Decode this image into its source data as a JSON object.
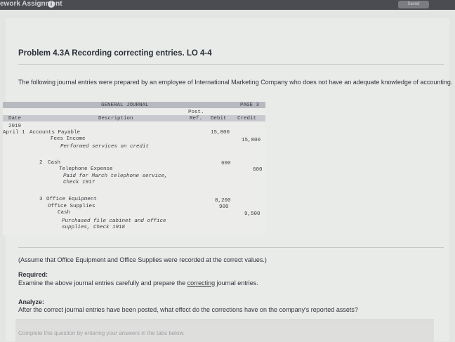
{
  "topbar": {
    "title": "ework Assignment",
    "info_icon": "i",
    "saved_label": "Saved"
  },
  "problem": {
    "title": "Problem 4.3A Recording correcting entries. LO 4-4",
    "intro": "The following journal entries were prepared by an employee of International Marketing Company who does not have an adequate knowledge of accounting."
  },
  "journal": {
    "heading": "GENERAL JOURNAL",
    "page": "PAGE 3",
    "columns": {
      "date": "Date",
      "description": "Description",
      "post_top": "Post.",
      "post_bottom": "Ref.",
      "debit": "Debit",
      "credit": "Credit"
    },
    "year": "2019",
    "entries": [
      {
        "date": "April 1",
        "lines": [
          {
            "text": "Accounts Payable",
            "debit": "15,800",
            "credit": ""
          },
          {
            "text": "Fees Income",
            "debit": "",
            "credit": "15,800"
          },
          {
            "text": "Performed services on credit",
            "debit": "",
            "credit": ""
          }
        ]
      },
      {
        "date": "2",
        "lines": [
          {
            "text": "Cash",
            "debit": "600",
            "credit": ""
          },
          {
            "text": "Telephone Expense",
            "debit": "",
            "credit": "600"
          },
          {
            "text": "Paid for March telephone service,",
            "debit": "",
            "credit": ""
          },
          {
            "text": "Check 1917",
            "debit": "",
            "credit": ""
          }
        ]
      },
      {
        "date": "3",
        "lines": [
          {
            "text": "Office Equipment",
            "debit": "8,200",
            "credit": ""
          },
          {
            "text": "Office Supplies",
            "debit": "900",
            "credit": ""
          },
          {
            "text": "Cash",
            "debit": "",
            "credit": "9,500"
          },
          {
            "text": "Purchased file cabinet and office",
            "debit": "",
            "credit": ""
          },
          {
            "text": "supplies, Check 1918",
            "debit": "",
            "credit": ""
          }
        ]
      }
    ]
  },
  "assume": "(Assume that Office Equipment and Office Supplies were recorded at the correct values.)",
  "required": {
    "label": "Required:",
    "text_before": "Examine the above journal entries carefully and prepare the ",
    "link": "correcting",
    "text_after": " journal entries."
  },
  "analyze": {
    "label": "Analyze:",
    "text": "After the correct journal entries have been posted, what effect do the corrections have on the company's reported assets?"
  },
  "footer_hint": "Complete this question by entering your answers in the tabs below."
}
